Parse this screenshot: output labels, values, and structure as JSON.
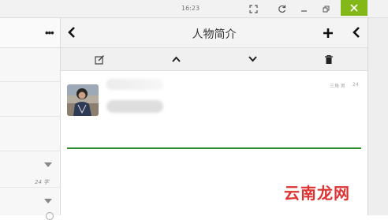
{
  "titlebar": {
    "time": "16:23"
  },
  "panel": {
    "title": "人物简介",
    "meta_gender": "三角 男",
    "meta_age": "24"
  },
  "left": {
    "count": "24 字"
  },
  "watermark": "云南龙网",
  "colors": {
    "accent": "#84b818",
    "divider": "#2d8a2d",
    "watermark": "#dd3333"
  },
  "icons": [
    "fullscreen-icon",
    "refresh-icon",
    "minimize-icon",
    "restore-icon",
    "close-icon",
    "more-icon",
    "back-icon",
    "add-icon",
    "edit-icon",
    "up-icon",
    "down-icon",
    "delete-icon"
  ]
}
